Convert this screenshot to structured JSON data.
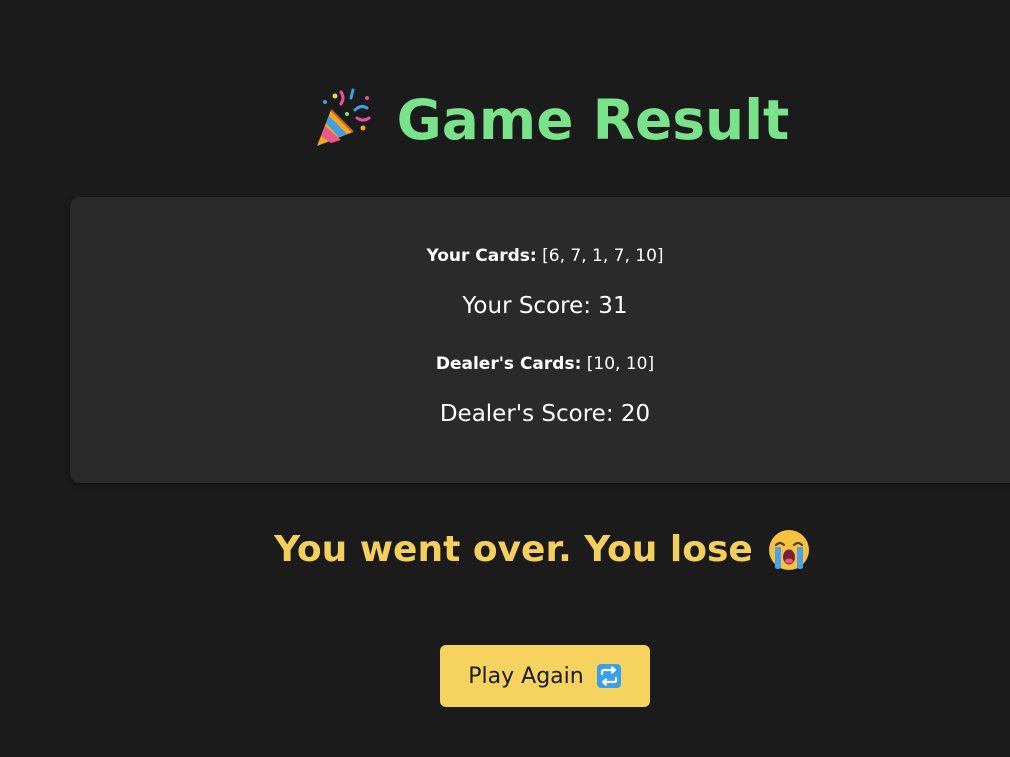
{
  "header": {
    "title": "Game Result",
    "title_icon": "party-popper-icon",
    "title_color": "#79e28a"
  },
  "summary": {
    "your_cards_label": "Your Cards:",
    "your_cards_value": "[6, 7, 1, 7, 10]",
    "your_score": "Your Score: 31",
    "dealer_cards_label": "Dealer's Cards:",
    "dealer_cards_value": "[10, 10]",
    "dealer_score": "Dealer's Score: 20"
  },
  "result": {
    "message": "You went over. You lose",
    "icon": "crying-face-icon",
    "color": "#f5cf5e"
  },
  "actions": {
    "play_again_label": "Play Again",
    "play_again_icon": "repeat-icon",
    "button_color": "#f5d35e"
  },
  "theme": {
    "background": "#1b1b1b",
    "panel": "#2a2a2a"
  }
}
